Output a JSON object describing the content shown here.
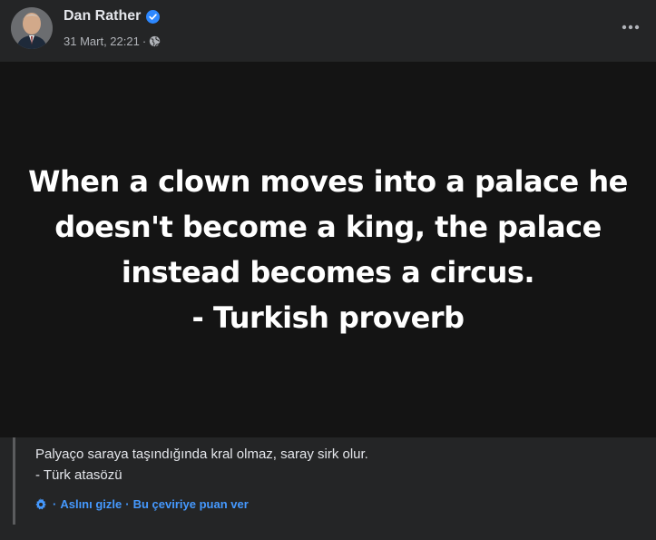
{
  "post": {
    "author": "Dan Rather",
    "timestamp": "31 Mart, 22:21",
    "privacy_icon": "globe-icon",
    "verified_icon": "verified-badge-icon",
    "more_icon": "more-options-icon"
  },
  "image": {
    "quote_lines": [
      "When a clown moves into a palace he",
      "doesn't become a king, the palace",
      "instead becomes a circus.",
      "- Turkish proverb"
    ]
  },
  "translation": {
    "lines": [
      "Palyaço saraya taşındığında kral olmaz, saray sirk olur.",
      "- Türk atasözü"
    ],
    "hide_original": "Aslını gizle",
    "rate_translation": "Bu çeviriye puan ver",
    "settings_icon": "gear-icon"
  },
  "colors": {
    "background": "#242526",
    "image_background": "#141414",
    "link": "#4599ff",
    "verified": "#2d88ff"
  }
}
